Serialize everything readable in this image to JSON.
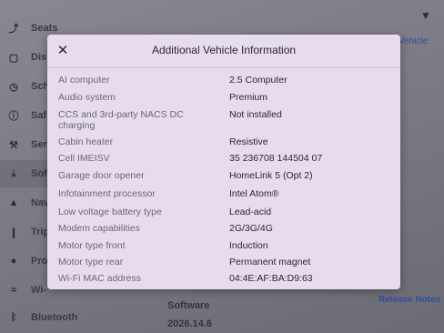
{
  "sidebar": {
    "items": [
      {
        "label": "Seats",
        "icon": "seat-icon"
      },
      {
        "label": "Dis",
        "icon": "display-icon"
      },
      {
        "label": "Sch",
        "icon": "schedule-icon"
      },
      {
        "label": "Saf",
        "icon": "safety-icon"
      },
      {
        "label": "Ser",
        "icon": "wrench-icon"
      },
      {
        "label": "Sof",
        "icon": "download-icon"
      },
      {
        "label": "Nav",
        "icon": "navigation-icon"
      },
      {
        "label": "Trip",
        "icon": "trips-icon"
      },
      {
        "label": "Pro",
        "icon": "profile-icon"
      },
      {
        "label": "Wi-",
        "icon": "wifi-icon"
      },
      {
        "label": "Bluetooth",
        "icon": "bluetooth-icon"
      }
    ]
  },
  "background": {
    "partial_link": "r Vehicle",
    "software_title": "Software",
    "software_version": "2026.14.6",
    "release_notes": "Release Notes"
  },
  "modal": {
    "title": "Additional Vehicle Information",
    "close_label": "✕",
    "rows": [
      {
        "key": "AI computer",
        "value": "2.5 Computer"
      },
      {
        "key": "Audio system",
        "value": "Premium"
      },
      {
        "key": "CCS and 3rd-party NACS DC charging",
        "value": "Not installed"
      },
      {
        "key": "Cabin heater",
        "value": "Resistive"
      },
      {
        "key": "Cell IMEISV",
        "value": "35 236708 144504 07"
      },
      {
        "key": "Garage door opener",
        "value": "HomeLink 5 (Opt 2)"
      },
      {
        "key": "Infotainment processor",
        "value": "Intel Atom®"
      },
      {
        "key": "Low voltage battery type",
        "value": "Lead-acid"
      },
      {
        "key": "Modem capabilities",
        "value": "2G/3G/4G"
      },
      {
        "key": "Motor type front",
        "value": "Induction"
      },
      {
        "key": "Motor type rear",
        "value": "Permanent magnet"
      },
      {
        "key": "Wi-Fi MAC address",
        "value": "04:4E:AF:BA:D9:63"
      }
    ]
  },
  "colors": {
    "modal_bg": "#e6dcec",
    "key_text": "#6c6873",
    "value_text": "#2a2830",
    "link": "#2f4fa0"
  }
}
